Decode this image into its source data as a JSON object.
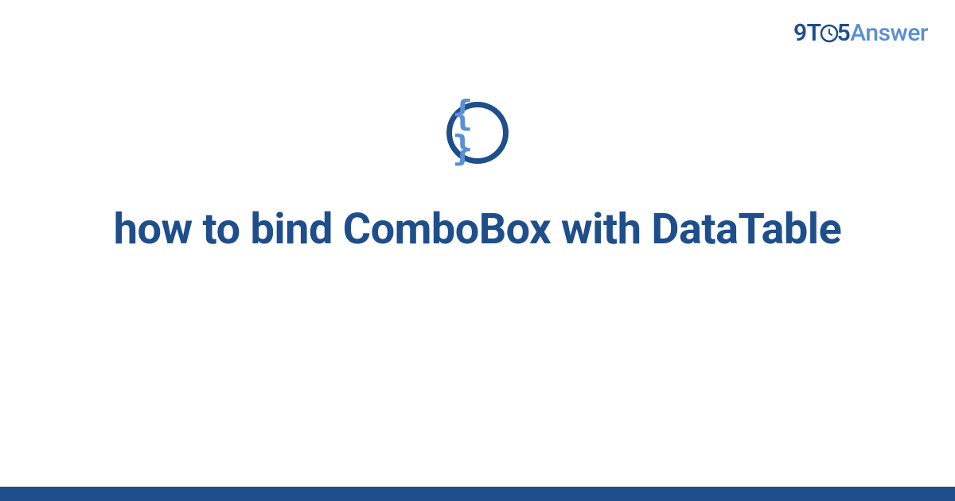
{
  "logo": {
    "prefix_9t": "9T",
    "suffix_5": "5",
    "answer": "Answer"
  },
  "icon": {
    "name": "code-braces-icon",
    "glyph": "{ }"
  },
  "title": "how to bind ComboBox with DataTable",
  "colors": {
    "primary": "#1e4e8c",
    "accent": "#5a8fd6"
  }
}
